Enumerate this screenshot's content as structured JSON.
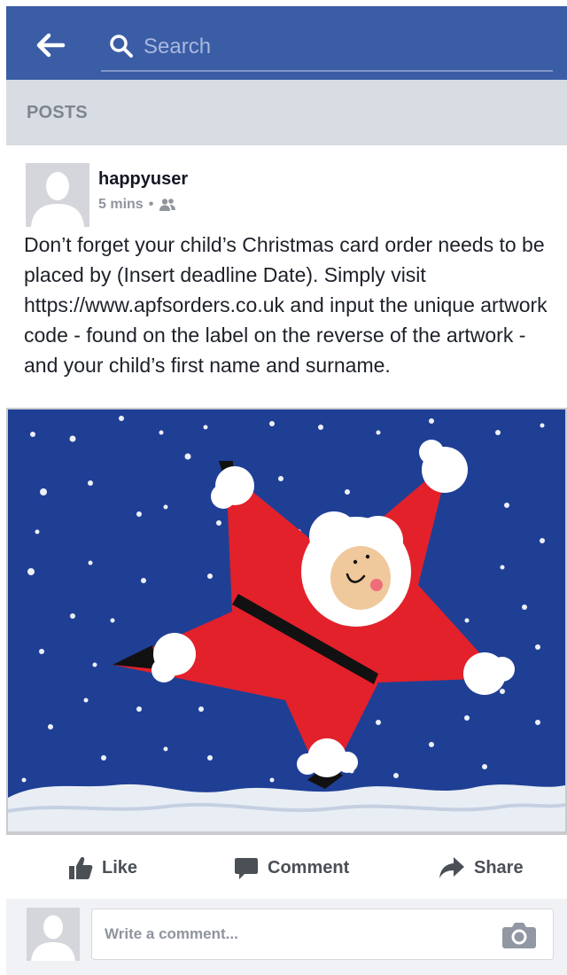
{
  "header": {
    "back_icon": "back-arrow-icon",
    "search_icon": "search-icon",
    "search_placeholder": "Search",
    "background_color": "#3b5da6"
  },
  "section": {
    "title": "POSTS"
  },
  "post": {
    "author": "happyuser",
    "time": "5 mins",
    "separator": "•",
    "audience_icon": "friends-icon",
    "text": "Don’t forget your child’s Christmas card order needs to be placed by (Insert deadline Date). Simply visit https://www.apfsorders.co.uk and input the unique artwork code - found on the label on the reverse of the artwork - and your child’s first name and surname.",
    "image": {
      "subject": "child's painting of a star-shaped Santa Claus on a snowy dark blue background",
      "icon": "santa-star-artwork"
    }
  },
  "actions": {
    "like_label": "Like",
    "comment_label": "Comment",
    "share_label": "Share"
  },
  "composer": {
    "placeholder": "Write a comment...",
    "camera_icon": "camera-icon"
  }
}
